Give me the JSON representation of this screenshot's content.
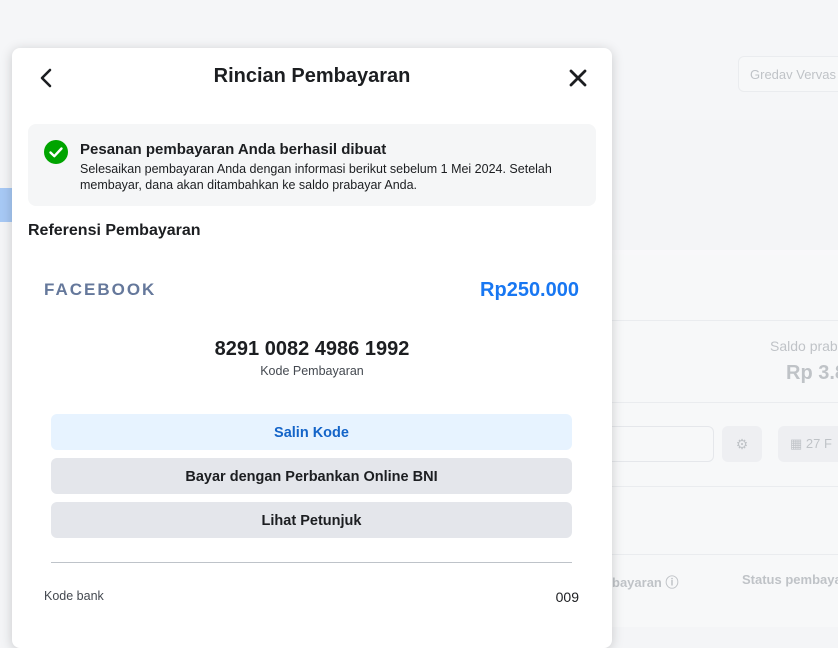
{
  "background": {
    "account_name": "Gredav Vervas",
    "saldo_label": "Saldo prabay",
    "saldo_value": "Rp 3.8",
    "date_filter": "27 F",
    "col_payment": "bayaran",
    "col_status": "Status pembaya"
  },
  "modal": {
    "title": "Rincian Pembayaran",
    "success": {
      "title": "Pesanan pembayaran Anda berhasil dibuat",
      "description": "Selesaikan pembayaran Anda dengan informasi berikut sebelum 1 Mei 2024. Setelah membayar, dana akan ditambahkan ke saldo prabayar Anda."
    },
    "reference_title": "Referensi Pembayaran",
    "merchant": "FACEBOOK",
    "amount": "Rp250.000",
    "payment_code": "8291 0082 4986 1992",
    "payment_code_label": "Kode Pembayaran",
    "buttons": {
      "copy": "Salin Kode",
      "bank": "Bayar dengan Perbankan Online BNI",
      "guide": "Lihat Petunjuk"
    },
    "bank_code_label": "Kode bank",
    "bank_code_value": "009"
  },
  "colors": {
    "accent": "#1877f2",
    "success": "#00a400",
    "merchant": "#65789b"
  }
}
